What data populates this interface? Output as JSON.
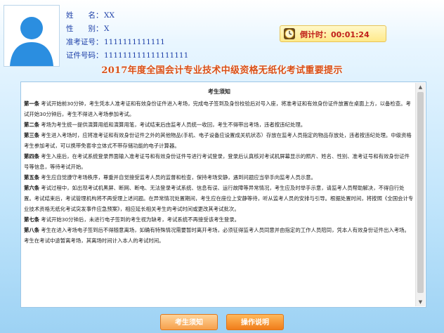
{
  "candidate": {
    "name_label": "姓　　名：",
    "name": "XX",
    "gender_label": "性　　别：",
    "gender": "X",
    "ticket_label": "准考证号：",
    "ticket": "1111111111111",
    "id_label": "证件号码：",
    "id": "111111111111111111"
  },
  "timer": {
    "label": "倒计时：",
    "value": "00:01:24",
    "icon": "clock-icon"
  },
  "banner": "2017年度全国会计专业技术中级资格无纸化考试重要提示",
  "notice": {
    "title": "考生须知",
    "rules": [
      {
        "n": "第一条",
        "t": "考试开始前30分钟，考生凭本人准考证和有效身份证件进入考场，完成电子签到及身份校验后对号入座，将准考证和有效身份证件放置在桌面上方，以备检查。考试开始30分钟后，考生不得进入考场参加考试。"
      },
      {
        "n": "第二条",
        "t": "考场为考生统一提供演算用纸和演算用笔，考试结束后由监考人员统一收回，考生不得带出考场，违者按违纪处理。"
      },
      {
        "n": "第三条",
        "t": "考生进入考场时，应将准考证和有效身份证件之外的其他物品(手机、电子设备应设置成关机状态）存放在监考人员指定的物品存放处，违者按违纪处理。中级资格考生参加考试，可以携带免套非立体式不带存储功能的电子计算器。"
      },
      {
        "n": "第四条",
        "t": "考生入座后，在考试系统登录界面输入准考证号和有效身份证件号进行考试登录，登录后认真核对考试机屏幕显示的照片、姓名、性别、准考证号和有效身份证件号等信息，等待考试开始。"
      },
      {
        "n": "第五条",
        "t": "考生应自觉遵守考场秩序，尊重并自觉接受监考人员的监督和检查，保持考场安静，遇到问题应当举手向监考人员示意。"
      },
      {
        "n": "第六条",
        "t": "考试过程中，如出现考试机黑屏、断网、断电、无法登录考试系统、信息有误、运行故障等异常情况，考生应及时举手示意，请监考人员帮助解决，不得自行处置。考试结束后，考试管理机构将不再受理上述问题。在异常情况处置期间，考生应在座位上安静等待，听从监考人员的安排与引导。根据处置时间，将按照《全国会计专业技术资格无纸化考试突发事件应急预案》，相应延长相关考生的考试时间或更改其考试批次。"
      },
      {
        "n": "第七条",
        "t": "考试开始30分钟后，未进行电子签到的考生视为缺考，考试系统不再接受该考生登录。"
      },
      {
        "n": "第八条",
        "t": "考生在进入考场电子签到后不得随意离场，如确有特殊情况需要暂时离开考场，必须征得监考人员同意并由指定的工作人员陪同，凭本人有效身份证件出入考场。考生在考试中途暂离考场，其离场时间计入本人的考试时间。"
      }
    ]
  },
  "buttons": {
    "notice": "考生须知",
    "guide": "操作说明"
  },
  "colors": {
    "accent": "#f07d1a",
    "timer_text": "#c0201a",
    "banner": "#d94f16",
    "info_text": "#1e40a8"
  }
}
